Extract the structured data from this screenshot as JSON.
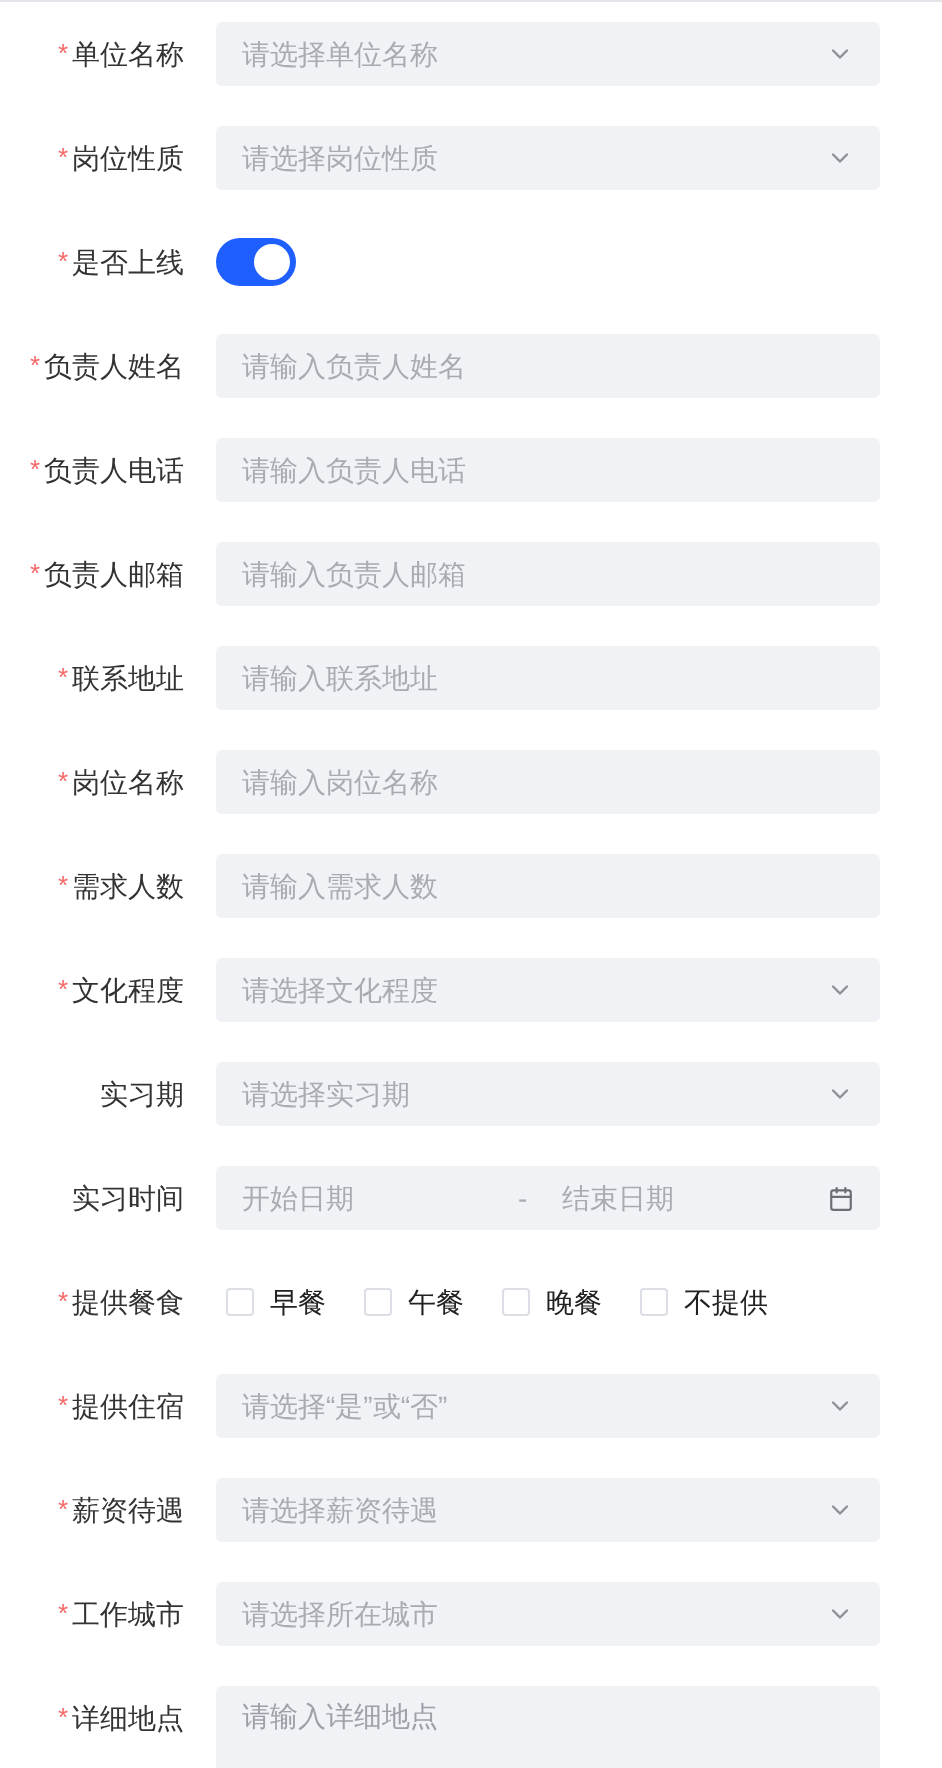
{
  "fields": [
    {
      "kind": "select",
      "required_mark": "*",
      "label": "单位名称",
      "placeholder": "请选择单位名称"
    },
    {
      "kind": "select",
      "required_mark": "*",
      "label": "岗位性质",
      "placeholder": "请选择岗位性质"
    },
    {
      "kind": "switch",
      "required_mark": "*",
      "label": "是否上线",
      "on": true
    },
    {
      "kind": "input",
      "required_mark": "*",
      "label": "负责人姓名",
      "placeholder": "请输入负责人姓名"
    },
    {
      "kind": "input",
      "required_mark": "*",
      "label": "负责人电话",
      "placeholder": "请输入负责人电话"
    },
    {
      "kind": "input",
      "required_mark": "*",
      "label": "负责人邮箱",
      "placeholder": "请输入负责人邮箱"
    },
    {
      "kind": "input",
      "required_mark": "*",
      "label": "联系地址",
      "placeholder": "请输入联系地址"
    },
    {
      "kind": "input",
      "required_mark": "*",
      "label": "岗位名称",
      "placeholder": "请输入岗位名称"
    },
    {
      "kind": "input",
      "required_mark": "*",
      "label": "需求人数",
      "placeholder": "请输入需求人数"
    },
    {
      "kind": "select",
      "required_mark": "*",
      "label": "文化程度",
      "placeholder": "请选择文化程度"
    },
    {
      "kind": "select",
      "label": "实习期",
      "placeholder": "请选择实习期"
    },
    {
      "kind": "daterange",
      "label": "实习时间",
      "start_placeholder": "开始日期",
      "separator": "-",
      "end_placeholder": "结束日期"
    },
    {
      "kind": "checkboxes",
      "required_mark": "*",
      "label": "提供餐食",
      "options": [
        {
          "label": "早餐",
          "checked": false
        },
        {
          "label": "午餐",
          "checked": false
        },
        {
          "label": "晚餐",
          "checked": false
        },
        {
          "label": "不提供",
          "checked": false
        }
      ]
    },
    {
      "kind": "select",
      "required_mark": "*",
      "label": "提供住宿",
      "placeholder": "请选择“是”或“否”"
    },
    {
      "kind": "select",
      "required_mark": "*",
      "label": "薪资待遇",
      "placeholder": "请选择薪资待遇"
    },
    {
      "kind": "select",
      "required_mark": "*",
      "label": "工作城市",
      "placeholder": "请选择所在城市"
    },
    {
      "kind": "textarea",
      "required_mark": "*",
      "label": "详细地点",
      "placeholder": "请输入详细地点"
    }
  ]
}
